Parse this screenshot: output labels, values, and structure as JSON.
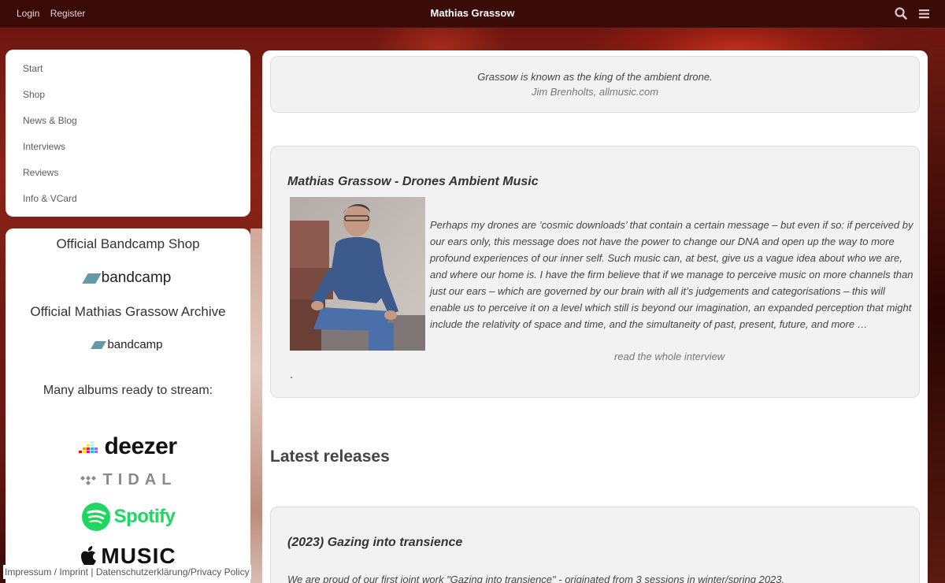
{
  "topbar": {
    "login": "Login",
    "register": "Register",
    "brand": "Mathias Grassow",
    "icons": [
      "search-icon",
      "menu-icon"
    ]
  },
  "nav": {
    "items": [
      {
        "label": "Start"
      },
      {
        "label": "Shop"
      },
      {
        "label": "News & Blog"
      },
      {
        "label": "Interviews"
      },
      {
        "label": "Reviews"
      },
      {
        "label": "Info & VCard"
      }
    ]
  },
  "shop": {
    "bandcamp_shop_title": "Official Bandcamp Shop",
    "bandcamp_logo": "bandcamp",
    "archive_title": "Official Mathias Grassow Archive",
    "archive_logo": "bandcamp",
    "stream_title": "Many albums ready to stream:",
    "services": {
      "deezer": "deezer",
      "tidal": "TIDAL",
      "spotify": "Spotify",
      "apple": "MUSIC"
    }
  },
  "footer": {
    "imprint": "Impressum / Imprint",
    "separator": " | ",
    "privacy": "Datenschutzerklärung/Privacy Policy"
  },
  "main": {
    "quote": {
      "text": "Grassow is known as the king of the ambient drone.",
      "source": "Jim Brenholts, allmusic.com"
    },
    "feature": {
      "title": "Mathias Grassow - Drones Ambient Music",
      "paragraph": "Perhaps my drones are ’cosmic downloads’ that contain a certain message – but even if so: if perceived by our ears only, this message does not have the power to change our DNA and open up the way to more profound experiences of our inner self. Such music can, at best, give us a vague idea about who we are, and where our home is. I have the firm believe that if we manage to perceive music on more channels than just our ears – which are governed by our brain with all it’s judgements and categorisations – this will enable us to perceive it on a level which still is beyond our imagination, an expanded perception that might include the relativity of space and time, and the simultaneity of past, present, future, and more …",
      "read_more": "read the whole interview",
      "dot": "."
    },
    "latest_title": "Latest releases",
    "release": {
      "title": "(2023) Gazing into transience",
      "text": "We are proud of our first joint work \"Gazing into transience\" - originated from 3 sessions in winter/spring 2023."
    }
  },
  "colors": {
    "topbar": "#3a0a07",
    "bandcamp_accent": "#629aa9",
    "spotify": "#1ed760"
  }
}
